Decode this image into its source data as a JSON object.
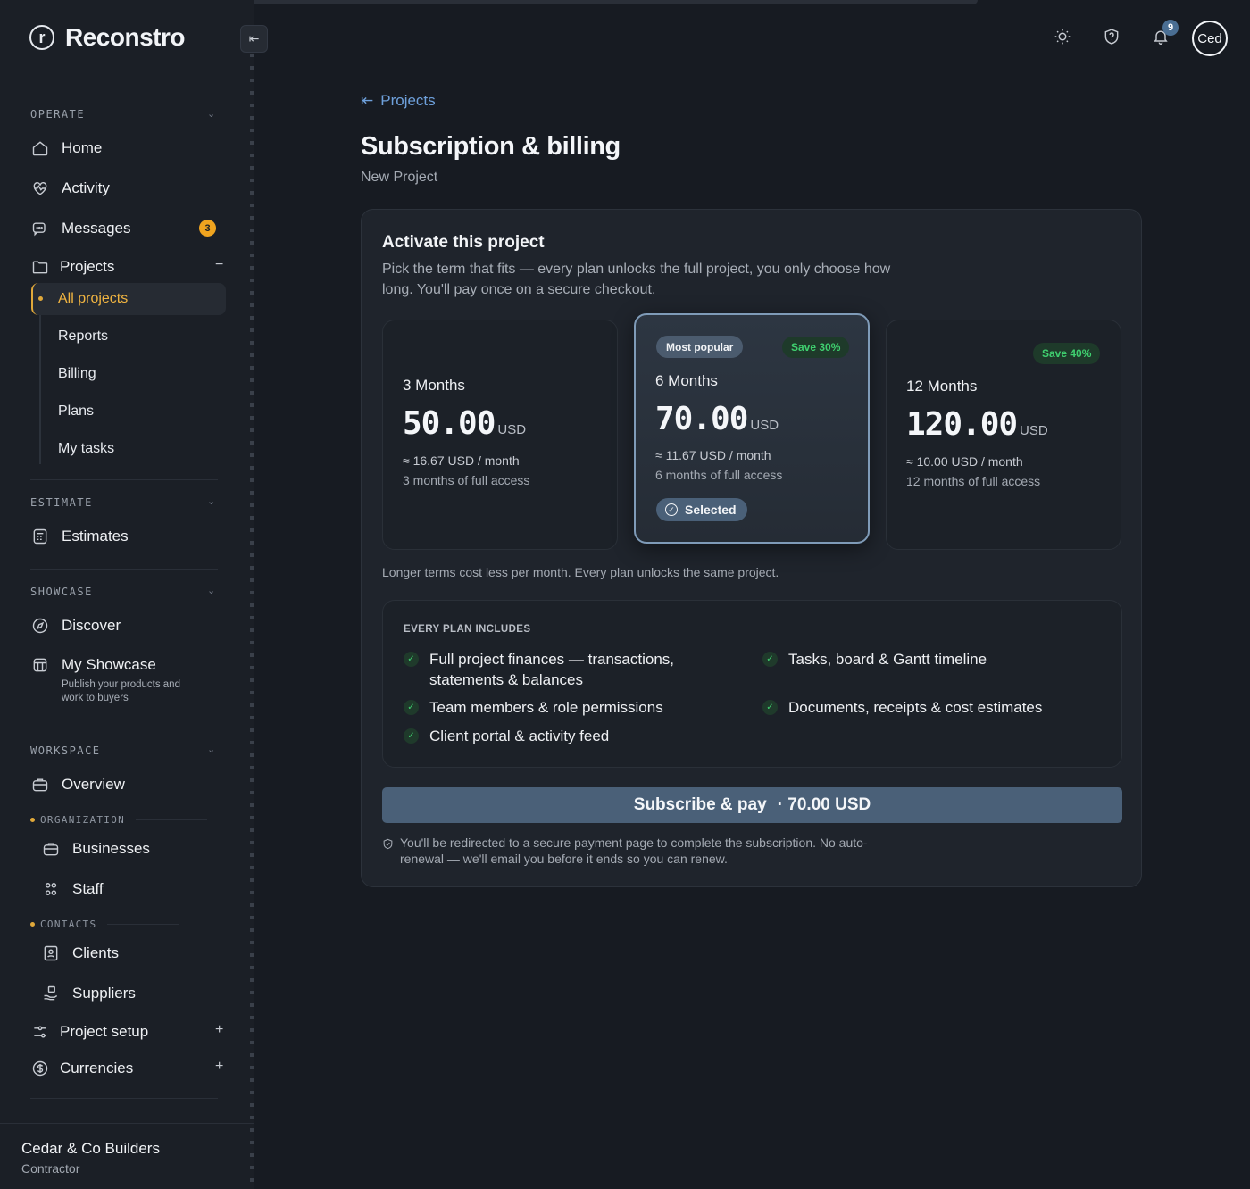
{
  "app": {
    "name": "Reconstro",
    "logo_letter": "r"
  },
  "sidebar": {
    "sections": {
      "operate": "OPERATE",
      "estimate": "ESTIMATE",
      "showcase": "SHOWCASE",
      "workspace": "WORKSPACE"
    },
    "operate_items": {
      "home": "Home",
      "activity": "Activity",
      "messages": "Messages",
      "messages_badge": "3",
      "projects": "Projects"
    },
    "projects_sub": {
      "all_projects": "All projects",
      "reports": "Reports",
      "billing": "Billing",
      "plans": "Plans",
      "my_tasks": "My tasks"
    },
    "estimate_items": {
      "estimates": "Estimates"
    },
    "showcase_items": {
      "discover": "Discover",
      "my_showcase": "My Showcase",
      "my_showcase_desc": "Publish your products and work to buyers"
    },
    "workspace_items": {
      "overview": "Overview",
      "organization_label": "ORGANIZATION",
      "businesses": "Businesses",
      "staff": "Staff",
      "contacts_label": "CONTACTS",
      "clients": "Clients",
      "suppliers": "Suppliers",
      "project_setup": "Project setup",
      "currencies": "Currencies"
    },
    "footer": {
      "company": "Cedar & Co Builders",
      "role": "Contractor"
    }
  },
  "header": {
    "notifications_count": "9",
    "avatar_text": "Ced"
  },
  "page": {
    "back_label": "Projects",
    "title": "Subscription & billing",
    "subtitle": "New Project"
  },
  "panel": {
    "title": "Activate this project",
    "description": "Pick the term that fits — every plan unlocks the full project, you only choose how long. You'll pay once on a secure checkout.",
    "plans": [
      {
        "term": "3 Months",
        "price": "50.00",
        "currency": "USD",
        "per_month": "≈ 16.67 USD / month",
        "access": "3 months of full access"
      },
      {
        "term": "6 Months",
        "price": "70.00",
        "currency": "USD",
        "per_month": "≈ 11.67 USD / month",
        "access": "6 months of full access",
        "popular": "Most popular",
        "save": "Save 30%",
        "selected_label": "Selected"
      },
      {
        "term": "12 Months",
        "price": "120.00",
        "currency": "USD",
        "per_month": "≈ 10.00 USD / month",
        "access": "12 months of full access",
        "save": "Save 40%"
      }
    ],
    "plans_note": "Longer terms cost less per month. Every plan unlocks the same project.",
    "includes": {
      "label": "EVERY PLAN INCLUDES",
      "features": [
        "Full project finances — transactions, statements & balances",
        "Tasks, board & Gantt timeline",
        "Team members & role permissions",
        "Documents, receipts & cost estimates",
        "Client portal & activity feed"
      ]
    },
    "subscribe": {
      "label": "Subscribe & pay",
      "amount": "· 70.00 USD"
    },
    "redirect_note": "You'll be redirected to a secure payment page to complete the subscription. No auto-renewal — we'll email you before it ends so you can renew."
  },
  "colors": {
    "accent_blue": "#6ea0db",
    "accent_orange": "#f0a41f",
    "success_green": "#3fcf6f",
    "button_slate": "#4a6078"
  }
}
